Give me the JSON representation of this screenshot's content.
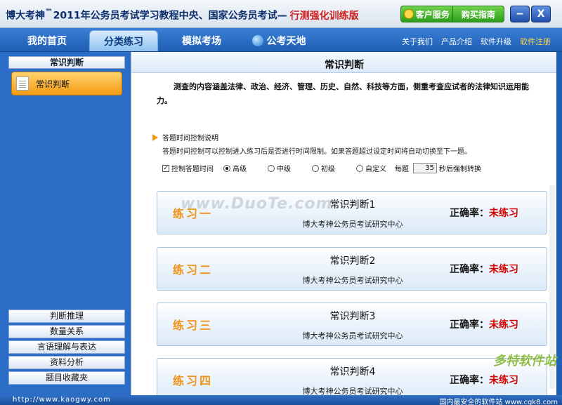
{
  "window": {
    "title_brand": "博大考神",
    "title_tm": "™",
    "title_main": "2011年公务员考试学习教程中央、国家公务员考试—",
    "title_sub": "行测强化训练版",
    "service_label": "客户服务",
    "buy_label": "购买指南",
    "minimize_glyph": "−",
    "close_glyph": "X"
  },
  "nav": {
    "tabs": [
      {
        "label": "我的首页"
      },
      {
        "label": "分类练习"
      },
      {
        "label": "模拟考场"
      },
      {
        "label": "公考天地"
      }
    ],
    "links": [
      {
        "label": "关于我们"
      },
      {
        "label": "产品介绍"
      },
      {
        "label": "软件升级"
      },
      {
        "label": "软件注册"
      }
    ]
  },
  "sidebar": {
    "header": "常识判断",
    "active_item": "常识判断",
    "categories": [
      {
        "label": "判断推理"
      },
      {
        "label": "数量关系"
      },
      {
        "label": "言语理解与表达"
      },
      {
        "label": "资料分析"
      },
      {
        "label": "题目收藏夹"
      }
    ]
  },
  "main": {
    "title": "常识判断",
    "description": "测查的内容涵盖法律、政治、经济、管理、历史、自然、科技等方面，侧重考查应试者的法律知识运用能力。",
    "time_control": {
      "heading": "答题时间控制说明",
      "text": "答题时间控制可以控制进入练习后是否进行时间限制。如果答题超过设定时间将自动切换至下一题。",
      "checkbox_label": "控制答题时间",
      "checkbox_checked": true,
      "options": [
        {
          "label": "高级",
          "selected": true
        },
        {
          "label": "中级",
          "selected": false
        },
        {
          "label": "初级",
          "selected": false
        },
        {
          "label": "自定义",
          "selected": false
        }
      ],
      "per_question_label": "每题",
      "seconds_value": "35",
      "seconds_suffix": "秒后强制转换"
    },
    "exercises": [
      {
        "label": "练习一",
        "title": "常识判断1",
        "org": "博大考神公务员考试研究中心",
        "accuracy_label": "正确率：",
        "accuracy_value": "未练习"
      },
      {
        "label": "练习二",
        "title": "常识判断2",
        "org": "博大考神公务员考试研究中心",
        "accuracy_label": "正确率：",
        "accuracy_value": "未练习"
      },
      {
        "label": "练习三",
        "title": "常识判断3",
        "org": "博大考神公务员考试研究中心",
        "accuracy_label": "正确率：",
        "accuracy_value": "未练习"
      },
      {
        "label": "练习四",
        "title": "常识判断4",
        "org": "博大考神公务员考试研究中心",
        "accuracy_label": "正确率：",
        "accuracy_value": "未练习"
      }
    ]
  },
  "watermark_text": "www.DuoTe.com",
  "statusbar": {
    "url": "http://www.kaogwy.com",
    "right_text": "国内最安全的软件站 www.cgk8.com"
  },
  "corner_logo": "多特软件站",
  "colors": {
    "accent_orange": "#f0931a",
    "accent_red": "#d60000",
    "nav_blue": "#1f5fb4"
  }
}
